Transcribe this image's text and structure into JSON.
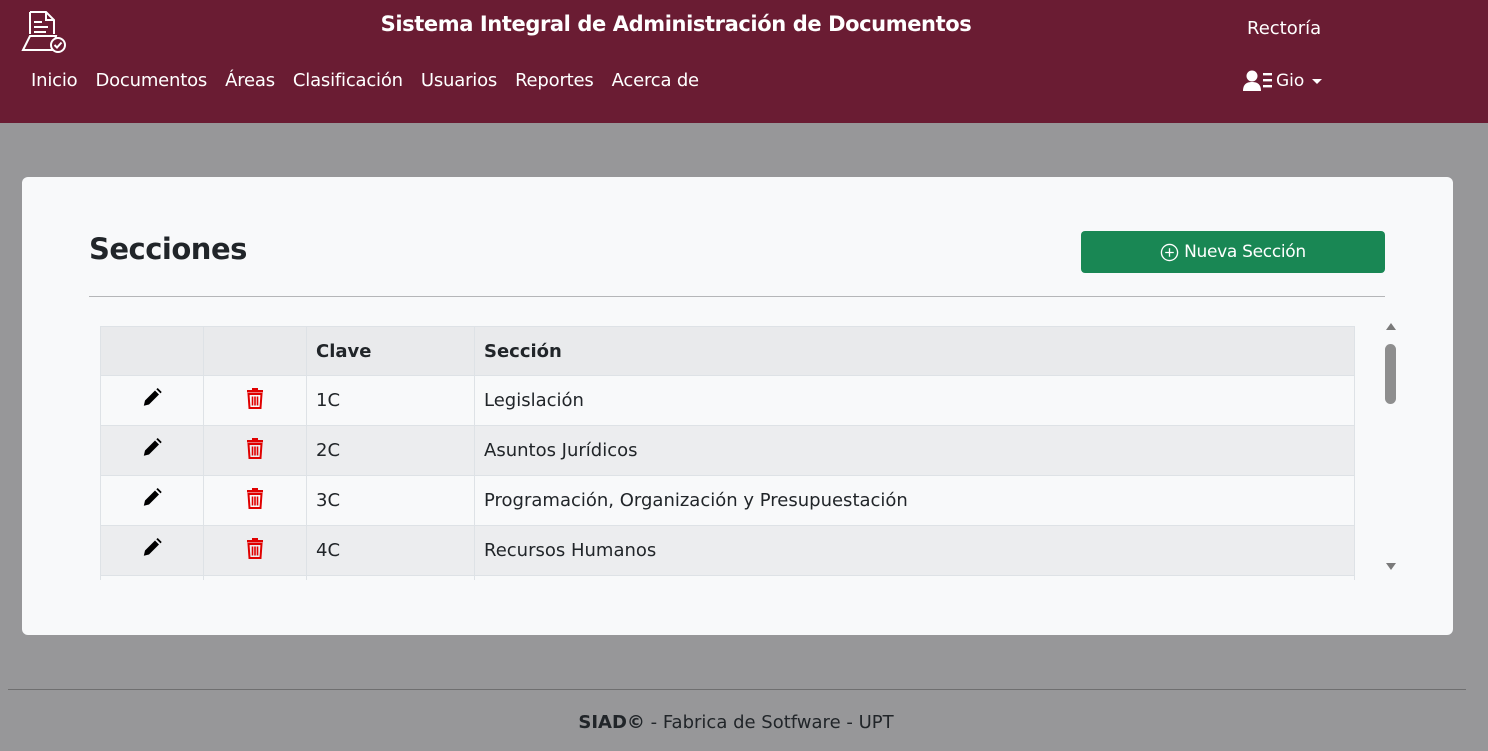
{
  "header": {
    "app_title": "Sistema Integral de Administración de Documentos",
    "org_name": "Rectoría",
    "user_name": "Gio",
    "nav": [
      "Inicio",
      "Documentos",
      "Áreas",
      "Clasificación",
      "Usuarios",
      "Reportes",
      "Acerca de"
    ],
    "brand_color": "#6a1c33"
  },
  "main": {
    "title": "Secciones",
    "new_button_label": "Nueva Sección",
    "table": {
      "columns": [
        "",
        "",
        "Clave",
        "Sección"
      ],
      "rows": [
        {
          "clave": "1C",
          "seccion": "Legislación"
        },
        {
          "clave": "2C",
          "seccion": "Asuntos Jurídicos"
        },
        {
          "clave": "3C",
          "seccion": "Programación, Organización y Presupuestación"
        },
        {
          "clave": "4C",
          "seccion": "Recursos Humanos"
        },
        {
          "clave": "",
          "seccion": ""
        }
      ]
    },
    "icons": {
      "edit": "pencil-icon",
      "delete": "trash-icon"
    },
    "button_color": "#198754",
    "delete_color": "#e00000"
  },
  "footer": {
    "brand": "SIAD©",
    "text": " - Fabrica de Sotfware - UPT"
  }
}
